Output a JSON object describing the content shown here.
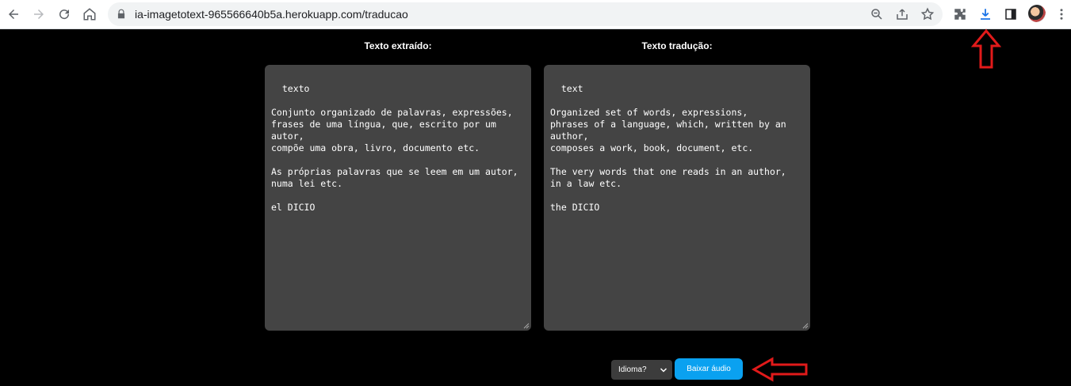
{
  "browser": {
    "url": "ia-imagetotext-965566640b5a.herokuapp.com/traducao",
    "icons": [
      "back-arrow-icon",
      "forward-arrow-icon",
      "reload-icon",
      "home-icon",
      "lock-icon",
      "zoom-icon",
      "share-icon",
      "star-icon",
      "extensions-icon",
      "download-icon",
      "side-panel-icon",
      "profile-avatar",
      "menu-kebab-icon"
    ]
  },
  "page": {
    "extracted_title": "Texto extraído:",
    "translated_title": "Texto tradução:",
    "extracted_text": "texto\n\nConjunto organizado de palavras, expressões,\nfrases de uma língua, que, escrito por um\nautor,\ncompõe uma obra, livro, documento etc.\n\nAs próprias palavras que se leem em um autor,\nnuma lei etc.\n\nel DICIO",
    "translated_text": "text\n\nOrganized set of words, expressions,\nphrases of a language, which, written by an\nauthor,\ncomposes a work, book, document, etc.\n\nThe very words that one reads in an author,\nin a law etc.\n\nthe DICIO",
    "language_select": "Idioma?",
    "download_button": "Baixar áudio"
  },
  "colors": {
    "page_bg": "#000000",
    "textarea_bg": "#444444",
    "button_blue": "#0aa1f0",
    "annotation_red": "#e11a1a",
    "download_icon_blue": "#1a73e8"
  }
}
